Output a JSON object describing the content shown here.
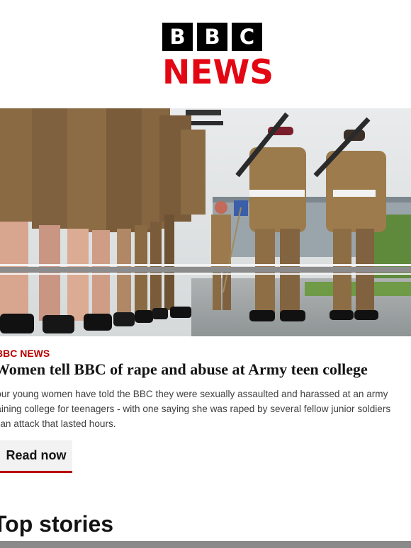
{
  "brand": {
    "letters": [
      "B",
      "B",
      "C"
    ],
    "news_label": "NEWS",
    "red": "#e30613",
    "accent_dark_red": "#b80000"
  },
  "hero": {
    "image": "soldiers-parade-photo"
  },
  "article": {
    "kicker": "BBC NEWS",
    "headline": "Women tell BBC of rape and abuse at Army teen college",
    "summary_lines": [
      "Four young women have told the BBC they were sexually assaulted and harassed at an army",
      "training college for teenagers - with one saying she was raped by several fellow junior soldiers",
      "in an attack that lasted hours."
    ],
    "cta_label": "Read now"
  },
  "top_stories": {
    "title": "Top stories"
  }
}
